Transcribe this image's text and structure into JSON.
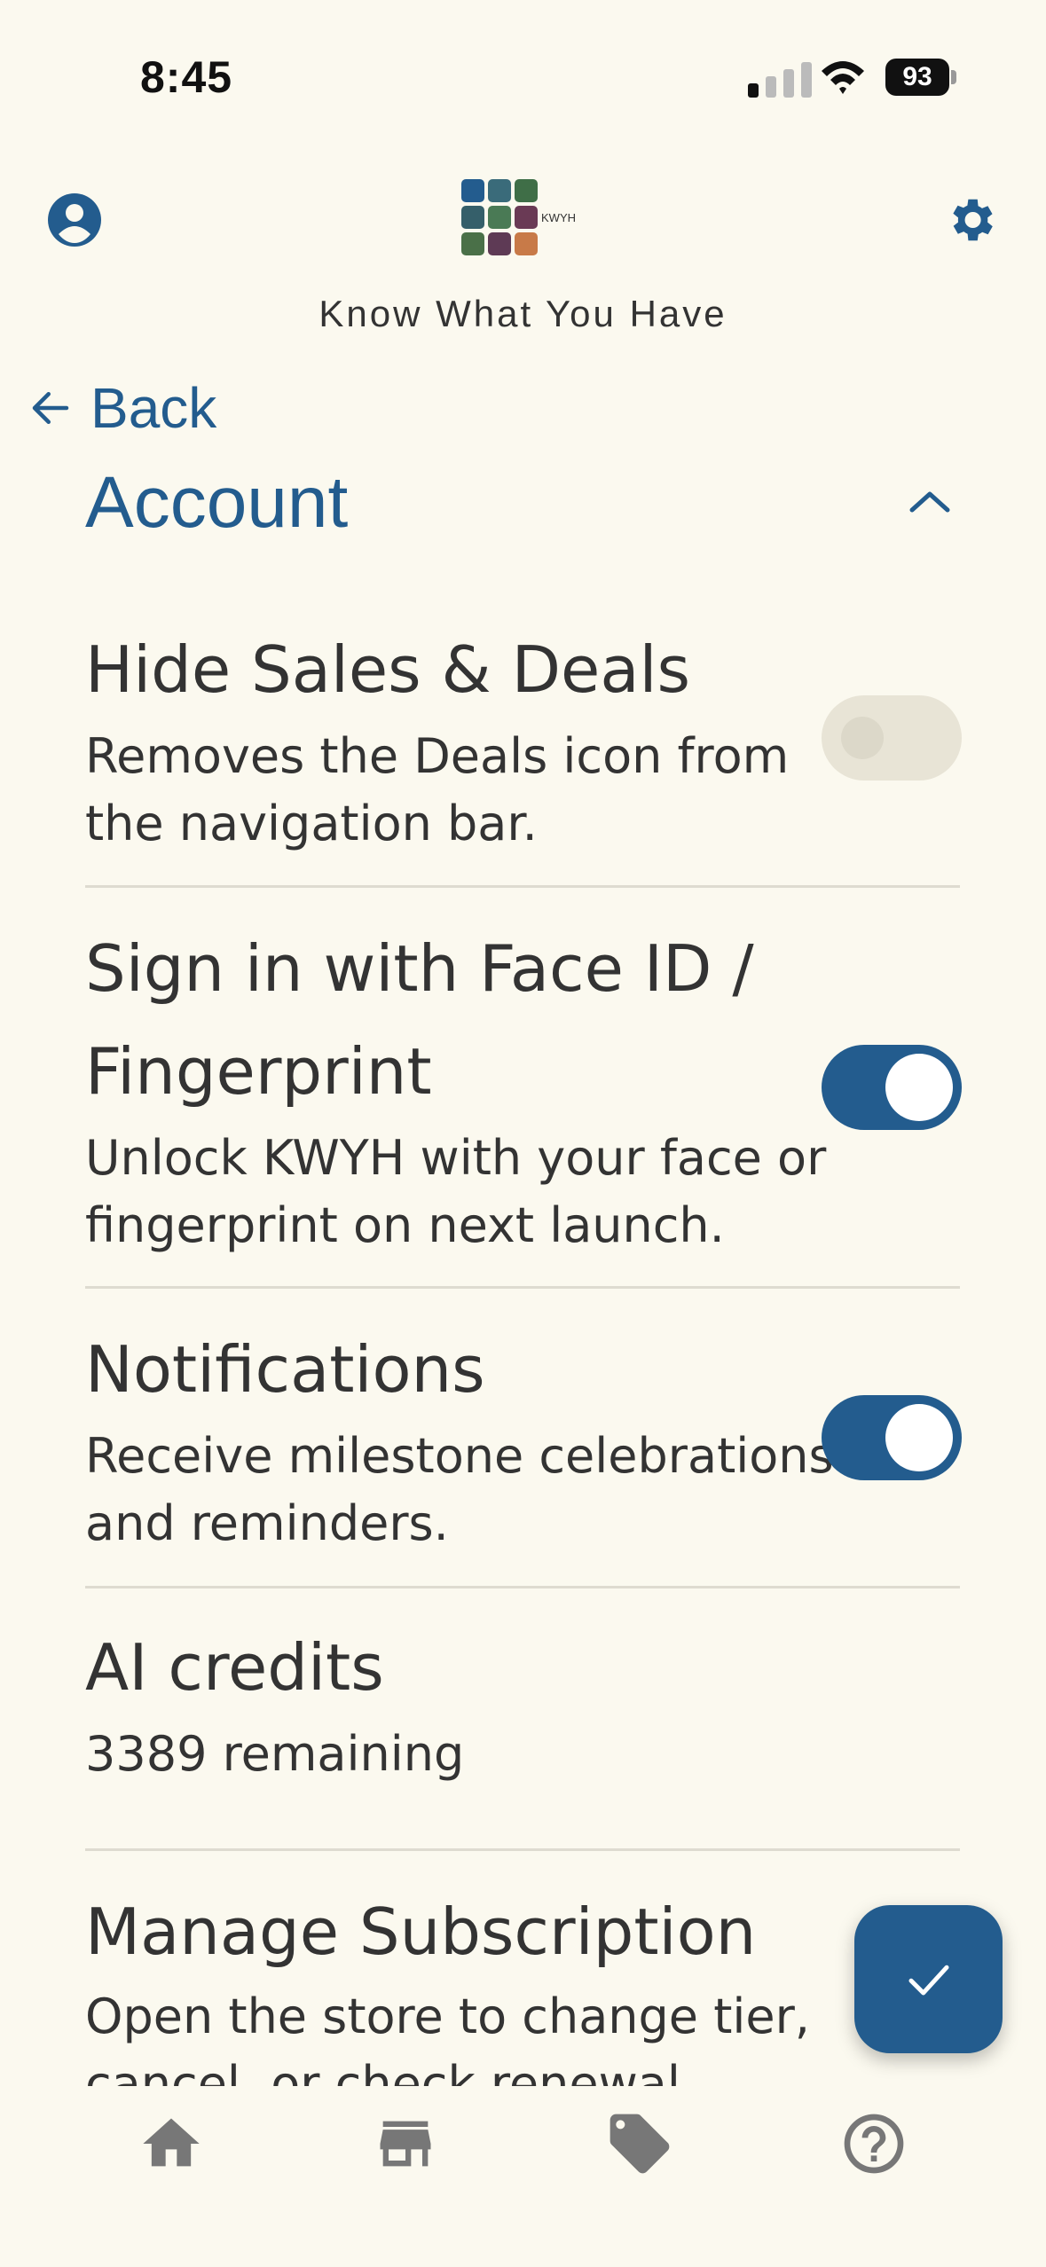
{
  "status_bar": {
    "time": "8:45",
    "battery": "93"
  },
  "header": {
    "brand": "Know What You Have",
    "logo_text": "KWYH"
  },
  "nav": {
    "back_label": "Back"
  },
  "section": {
    "title": "Account"
  },
  "settings": [
    {
      "title_lines": [
        "Hide Sales & Deals"
      ],
      "desc_lines": [
        "Removes the Deals icon from",
        "the navigation bar."
      ],
      "toggle": "off"
    },
    {
      "title_lines": [
        "Sign in with Face ID /",
        "Fingerprint"
      ],
      "desc_lines": [
        "Unlock KWYH with your face or",
        "fingerprint on next launch."
      ],
      "toggle": "on"
    },
    {
      "title_lines": [
        "Notifications"
      ],
      "desc_lines": [
        "Receive milestone celebrations",
        "and reminders."
      ],
      "toggle": "on"
    },
    {
      "title_lines": [
        "AI credits"
      ],
      "desc_lines": [
        "3389 remaining"
      ]
    },
    {
      "title_lines": [
        "Manage Subscription"
      ],
      "desc_lines": [
        "Open the store to change tier,",
        "cancel, or check renewal"
      ]
    }
  ],
  "colors": {
    "accent": "#235c8e",
    "background": "#fbf9ef",
    "text": "#333333"
  },
  "bottom_nav": {
    "items": [
      "home-icon",
      "store-icon",
      "tag-icon",
      "help-icon"
    ]
  }
}
